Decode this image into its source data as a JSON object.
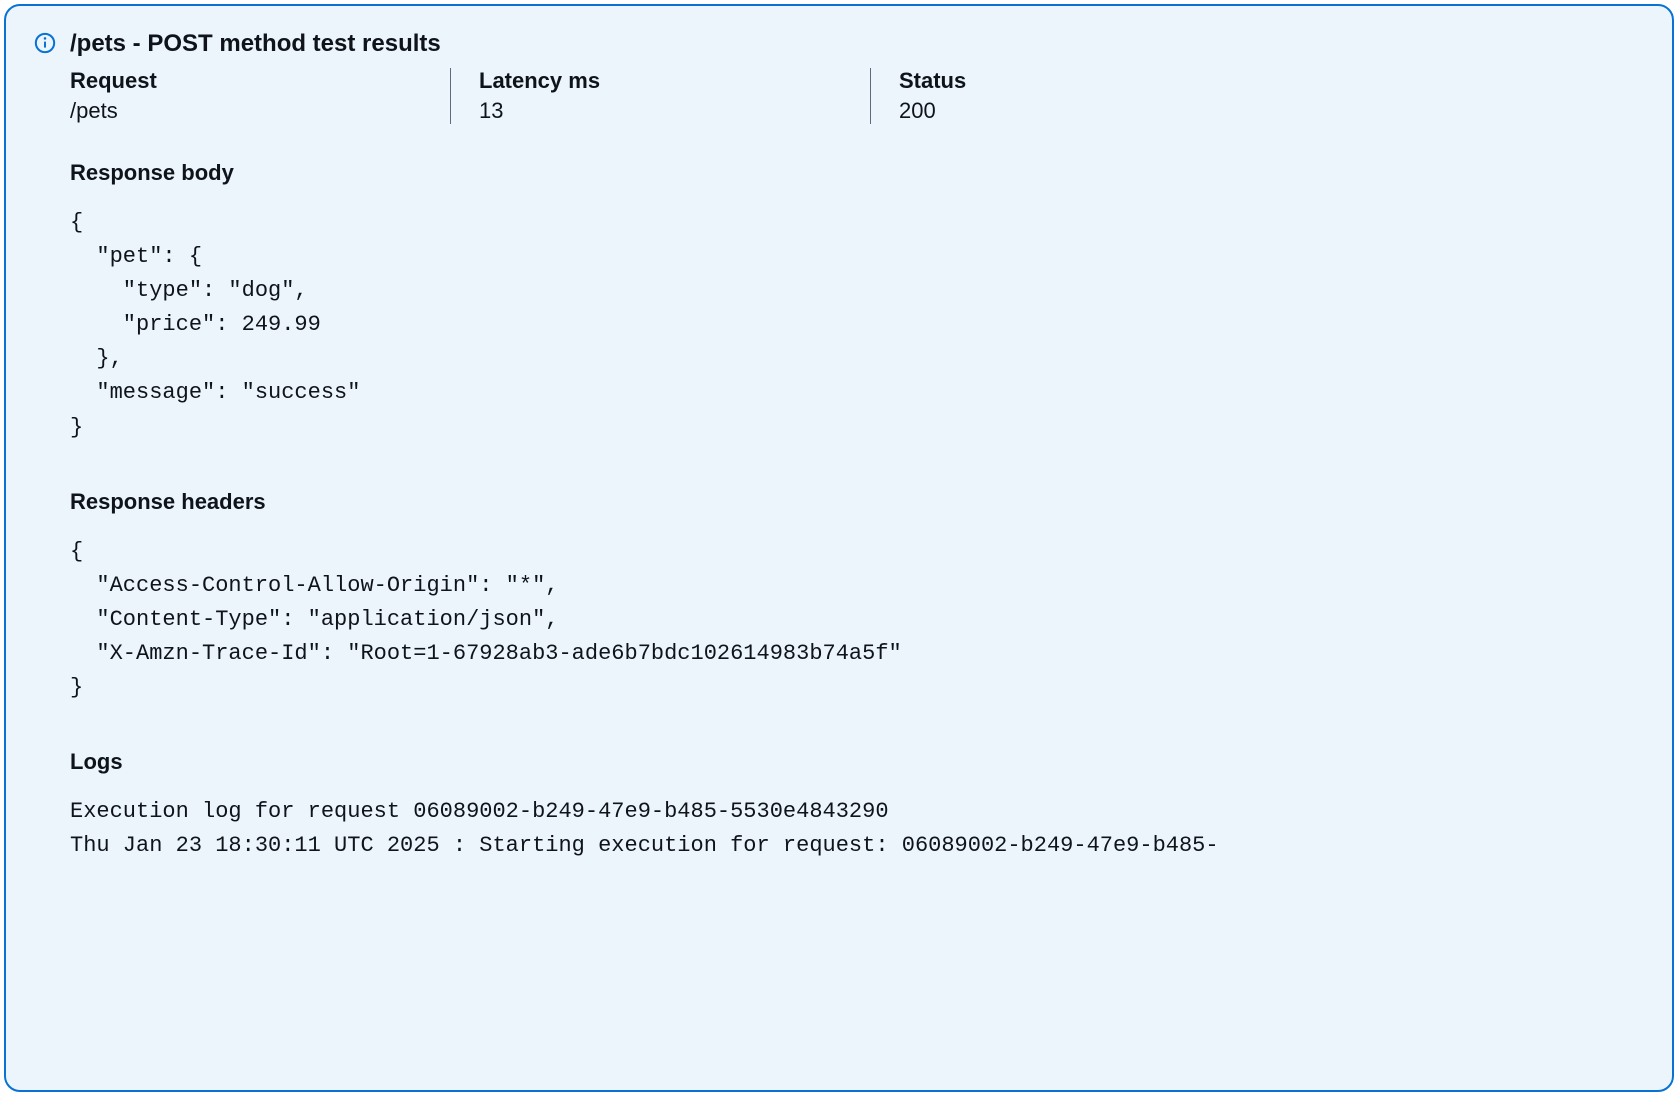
{
  "title": "/pets - POST method test results",
  "summary": {
    "request": {
      "label": "Request",
      "value": "/pets"
    },
    "latency": {
      "label": "Latency ms",
      "value": "13"
    },
    "status": {
      "label": "Status",
      "value": "200"
    }
  },
  "responseBody": {
    "title": "Response body",
    "content": "{\n  \"pet\": {\n    \"type\": \"dog\",\n    \"price\": 249.99\n  },\n  \"message\": \"success\"\n}"
  },
  "responseHeaders": {
    "title": "Response headers",
    "content": "{\n  \"Access-Control-Allow-Origin\": \"*\",\n  \"Content-Type\": \"application/json\",\n  \"X-Amzn-Trace-Id\": \"Root=1-67928ab3-ade6b7bdc102614983b74a5f\"\n}"
  },
  "logs": {
    "title": "Logs",
    "content": "Execution log for request 06089002-b249-47e9-b485-5530e4843290\nThu Jan 23 18:30:11 UTC 2025 : Starting execution for request: 06089002-b249-47e9-b485-"
  }
}
